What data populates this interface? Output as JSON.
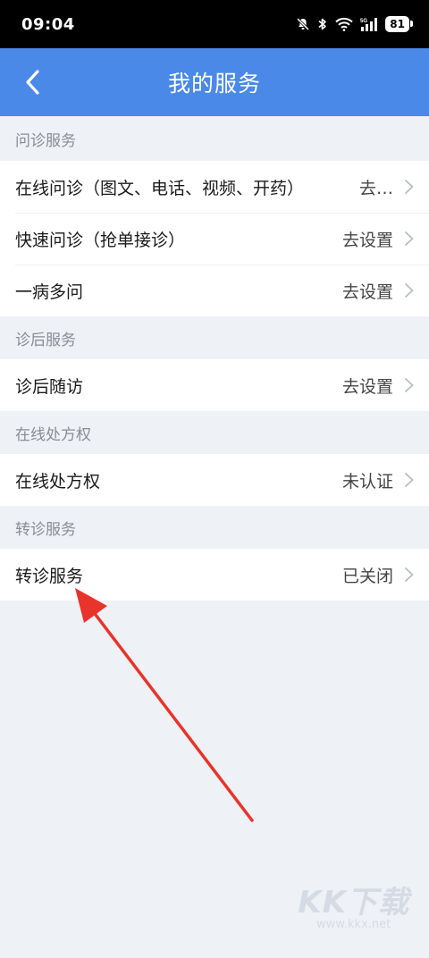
{
  "status_bar": {
    "time": "09:04",
    "battery": "81"
  },
  "header": {
    "title": "我的服务"
  },
  "sections": [
    {
      "title": "问诊服务",
      "rows": [
        {
          "label": "在线问诊（图文、电话、视频、开药）",
          "status": "去设置"
        },
        {
          "label": "快速问诊（抢单接诊）",
          "status": "去设置"
        },
        {
          "label": "一病多问",
          "status": "去设置"
        }
      ]
    },
    {
      "title": "诊后服务",
      "rows": [
        {
          "label": "诊后随访",
          "status": "去设置"
        }
      ]
    },
    {
      "title": "在线处方权",
      "rows": [
        {
          "label": "在线处方权",
          "status": "未认证"
        }
      ]
    },
    {
      "title": "转诊服务",
      "rows": [
        {
          "label": "转诊服务",
          "status": "已关闭"
        }
      ]
    }
  ],
  "watermark": {
    "logo": "KK下载",
    "url": "www.kkx.net"
  },
  "colors": {
    "nav": "#4a89e8",
    "background": "#eef1f6",
    "annotation": "#e8342a"
  }
}
